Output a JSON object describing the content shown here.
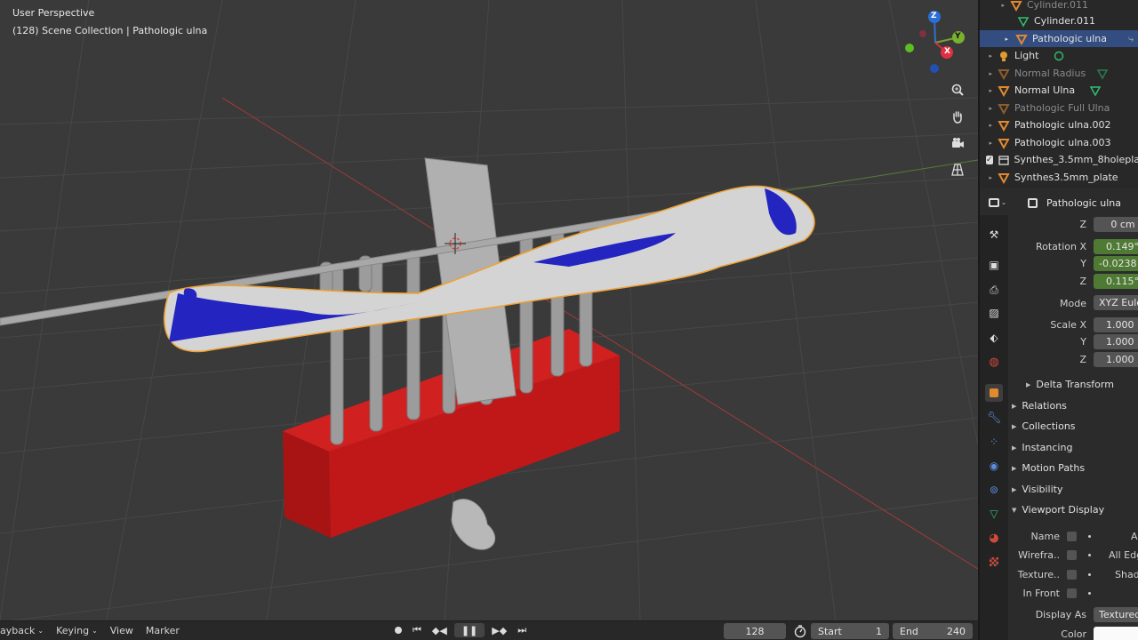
{
  "viewport": {
    "perspective_label": "User Perspective",
    "collection_label": "(128) Scene Collection | Pathologic ulna",
    "gizmo": {
      "z": "Z",
      "y": "Y",
      "x": "X"
    }
  },
  "timeline": {
    "menus": [
      "ayback",
      "Keying",
      "View",
      "Marker"
    ],
    "current_frame": "128",
    "start_label": "Start",
    "start_value": "1",
    "end_label": "End",
    "end_value": "240"
  },
  "outliner": {
    "rows": [
      {
        "label": "Cylinder.011",
        "icon": "object-icon",
        "state": "dim"
      },
      {
        "label": "Cylinder.011",
        "icon": "mesh-data-icon",
        "state": "normal"
      },
      {
        "label": "Pathologic ulna",
        "icon": "object-icon",
        "state": "selected"
      },
      {
        "label": "Light",
        "icon": "light-icon",
        "state": "normal"
      },
      {
        "label": "Normal Radius",
        "icon": "object-icon",
        "state": "dim"
      },
      {
        "label": "Normal Ulna",
        "icon": "object-icon",
        "state": "normal"
      },
      {
        "label": "Pathologic Full Ulna",
        "icon": "object-icon",
        "state": "dim"
      },
      {
        "label": "Pathologic ulna.002",
        "icon": "object-icon",
        "state": "normal"
      },
      {
        "label": "Pathologic ulna.003",
        "icon": "object-icon",
        "state": "normal"
      },
      {
        "label": "Synthes_3.5mm_8holepla",
        "icon": "collection-icon",
        "state": "normal"
      },
      {
        "label": "Synthes3.5mm_plate",
        "icon": "object-icon",
        "state": "normal"
      }
    ]
  },
  "properties": {
    "object_name": "Pathologic ulna",
    "location_z_label": "Z",
    "location_z": "0 cm",
    "rotation_x_label": "Rotation X",
    "rotation_x": "0.149°",
    "rotation_y_label": "Y",
    "rotation_y": "-0.0238",
    "rotation_z_label": "Z",
    "rotation_z": "0.115°",
    "mode_label": "Mode",
    "mode": "XYZ Eule",
    "scale_x_label": "Scale X",
    "scale_x": "1.000",
    "scale_y_label": "Y",
    "scale_y": "1.000",
    "scale_z_label": "Z",
    "scale_z": "1.000",
    "panels": {
      "delta_transform": "Delta Transform",
      "relations": "Relations",
      "collections": "Collections",
      "instancing": "Instancing",
      "motion_paths": "Motion Paths",
      "visibility": "Visibility",
      "viewport_display": "Viewport Display"
    },
    "display": {
      "name_label": "Name",
      "wireframe_label": "Wirefra..",
      "texture_label": "Texture..",
      "in_front_label": "In Front",
      "axes_label": "A",
      "all_edges_label": "All Edg",
      "shadow_label": "Shad",
      "display_as_label": "Display As",
      "display_as": "Textured",
      "color_label": "Color"
    }
  },
  "colors": {
    "selection": "#334d80",
    "accent_green": "#4f7a33",
    "bone_outline": "#f0a030",
    "block_red": "#c81818",
    "plate_blue": "#2020b8"
  }
}
